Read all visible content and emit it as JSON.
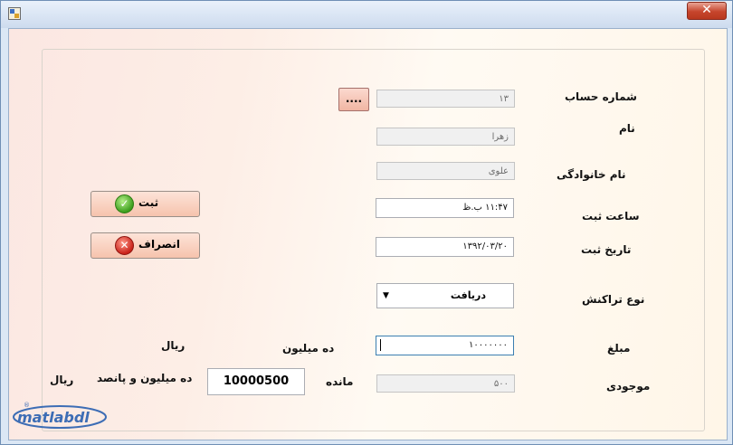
{
  "window": {
    "close_glyph": "✕"
  },
  "labels": {
    "account_number": "شماره حساب",
    "first_name": "نام",
    "last_name": "نام خانوادگی",
    "record_time": "ساعت ثبت",
    "record_date": "تاریخ ثبت",
    "transaction_type": "نوع تراکنش",
    "amount": "مبلغ",
    "balance": "موجودی",
    "remaining": "مانده",
    "amount_in_words": "ده میلیون",
    "currency_1": "ریال",
    "remaining_in_words": "ده میلیون و پانصد",
    "currency_2": "ریال"
  },
  "fields": {
    "account_number": "۱۳",
    "first_name": "زهرا",
    "last_name": "علوی",
    "record_time": "۱۱:۴۷ ب.ظ",
    "record_date": "۱۳۹۲/۰۳/۲۰",
    "transaction_type": "دریافت",
    "amount": "۱۰۰۰۰۰۰۰",
    "balance": "۵۰۰",
    "remaining": "10000500"
  },
  "buttons": {
    "browse": "....",
    "submit": "ثبت",
    "cancel": "انصراف"
  },
  "icons": {
    "submit": "✓",
    "cancel": "✕",
    "dropdown": "▼"
  },
  "logo": {
    "text": "matlabdl",
    "mark": "®"
  }
}
